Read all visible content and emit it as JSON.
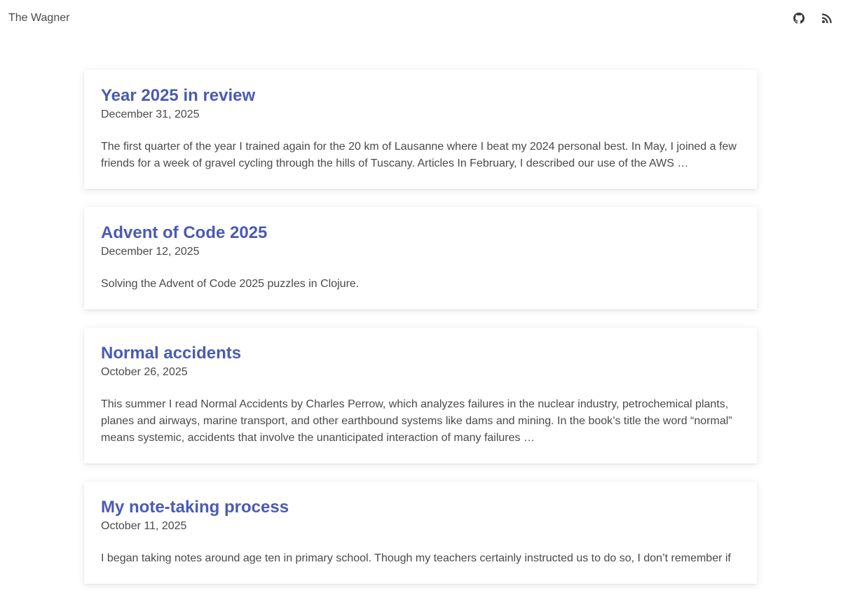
{
  "header": {
    "site_title": "The Wagner",
    "icons": [
      "github-icon",
      "rss-icon"
    ]
  },
  "colors": {
    "link": "#4a5ab5",
    "text": "#4a4a4a",
    "background": "#ffffff"
  },
  "posts": [
    {
      "title": "Year 2025 in review",
      "date": "December 31, 2025",
      "excerpt": "The first quarter of the year I trained again for the 20 km of Lausanne where I beat my 2024 personal best. In May, I joined a few friends for a week of gravel cycling through the hills of Tuscany. Articles In February, I described our use of the AWS …"
    },
    {
      "title": "Advent of Code 2025",
      "date": "December 12, 2025",
      "excerpt": "Solving the Advent of Code 2025 puzzles in Clojure."
    },
    {
      "title": "Normal accidents",
      "date": "October 26, 2025",
      "excerpt": "This summer I read Normal Accidents by Charles Perrow, which analyzes failures in the nuclear industry, petrochemical plants, planes and airways, marine transport, and other earthbound systems like dams and mining. In the book’s title the word “normal” means systemic, accidents that involve the unanticipated interaction of many failures …"
    },
    {
      "title": "My note-taking process",
      "date": "October 11, 2025",
      "excerpt": "I began taking notes around age ten in primary school. Though my teachers certainly instructed us to do so, I don’t remember if"
    }
  ]
}
